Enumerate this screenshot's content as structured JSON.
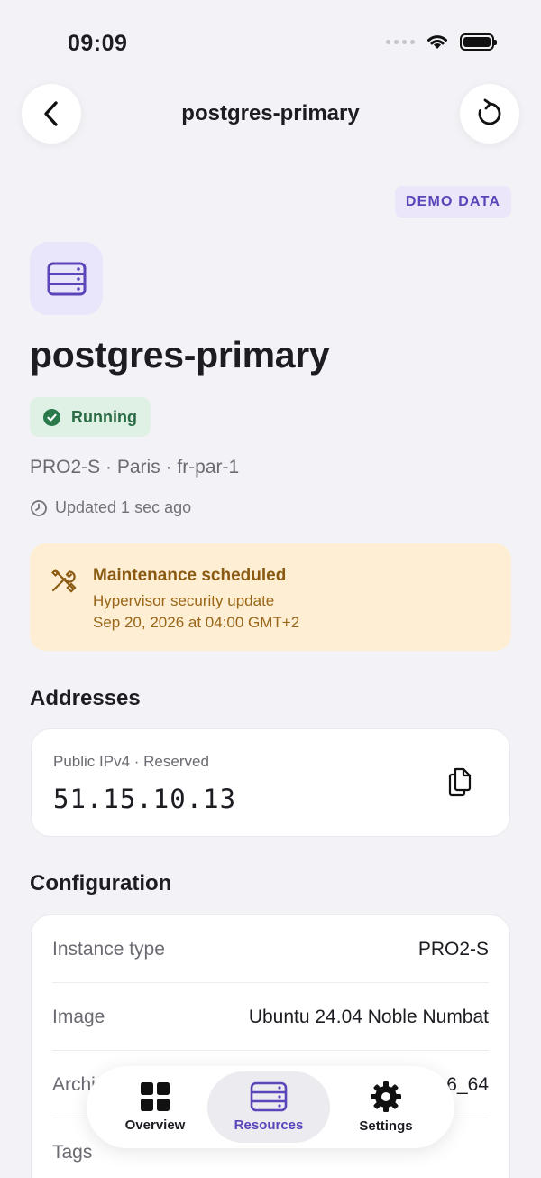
{
  "status_bar": {
    "time": "09:09"
  },
  "nav": {
    "title": "postgres-primary"
  },
  "badge": "DEMO DATA",
  "hero": {
    "title": "postgres-primary",
    "status": "Running",
    "meta": "PRO2-S · Paris · fr-par-1",
    "updated": "Updated 1 sec ago"
  },
  "maintenance": {
    "title": "Maintenance scheduled",
    "description": "Hypervisor security update",
    "date": "Sep 20, 2026 at 04:00 GMT+2"
  },
  "addresses": {
    "section_title": "Addresses",
    "label": "Public IPv4 · Reserved",
    "value": "51.15.10.13"
  },
  "configuration": {
    "section_title": "Configuration",
    "rows": [
      {
        "key": "Instance type",
        "value": "PRO2-S"
      },
      {
        "key": "Image",
        "value": "Ubuntu 24.04 Noble Numbat"
      },
      {
        "key": "Archi",
        "value": "6_64"
      },
      {
        "key": "Tags",
        "value": ""
      }
    ]
  },
  "tab_bar": {
    "tabs": [
      {
        "label": "Overview",
        "icon": "grid-icon"
      },
      {
        "label": "Resources",
        "icon": "server-icon"
      },
      {
        "label": "Settings",
        "icon": "gear-icon"
      }
    ],
    "active": "Resources"
  },
  "colors": {
    "accent": "#5b45b8",
    "running": "#2a6b45",
    "warning_bg": "#fdeed4",
    "warning_text": "#8a5a12"
  }
}
